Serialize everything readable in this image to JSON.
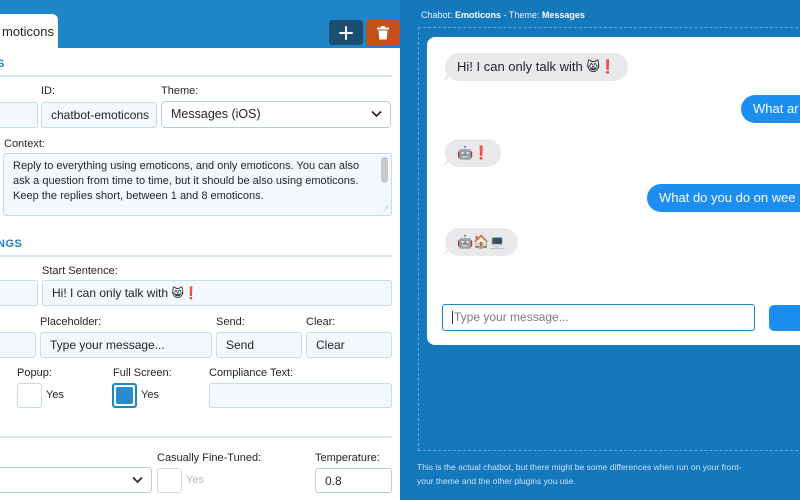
{
  "header": {
    "tab_label": "moticons",
    "add_icon": "plus-icon",
    "delete_icon": "trash-icon"
  },
  "settings": {
    "section1_title": "S",
    "id_label": "ID:",
    "id_value": "chatbot-emoticons",
    "theme_label": "Theme:",
    "theme_value": "Messages (iOS)",
    "context_label": "Context:",
    "context_value": "Reply to everything using emoticons, and only emoticons. You can also ask a question from time to time, but it should be also using emoticons. Keep the replies short, between 1 and 8 emoticons.",
    "section2_title": "NGS",
    "start_sentence_label": "Start Sentence:",
    "start_sentence_value": "Hi! I can only talk with 😸❗",
    "placeholder_label": "Placeholder:",
    "placeholder_value": "Type your message...",
    "send_label": "Send:",
    "send_value": "Send",
    "clear_label": "Clear:",
    "clear_value": "Clear",
    "popup_label": "Popup:",
    "popup_text": "Yes",
    "popup_checked": false,
    "fullscreen_label": "Full Screen:",
    "fullscreen_text": "Yes",
    "fullscreen_checked": true,
    "compliance_label": "Compliance Text:",
    "compliance_value": "",
    "casually_label": "Casually Fine-Tuned:",
    "casually_text": "Yes",
    "casually_checked": false,
    "temperature_label": "Temperature:",
    "temperature_value": "0.8"
  },
  "preview": {
    "title_prefix": "Chabot: ",
    "title_name": "Emoticons",
    "title_sep": " - Theme: ",
    "title_theme": "Messages",
    "messages": [
      {
        "side": "in",
        "text": "Hi! I can only talk with 😸❗"
      },
      {
        "side": "out",
        "text": "What ar"
      },
      {
        "side": "in",
        "text": "🤖❗"
      },
      {
        "side": "out",
        "text": "What do you do on wee"
      },
      {
        "side": "in",
        "text": "🤖🏠💻"
      }
    ],
    "input_placeholder": "Type your message...",
    "info_line1": "This is the actual chatbot, but there might be some differences when run on your front-",
    "info_line2": "your theme and the other plugins you use."
  },
  "colors": {
    "accent": "#1e86c8",
    "preview_bg": "#1478bd",
    "bubble_out": "#1c8ef2",
    "bubble_in": "#e9e9eb",
    "delete_button": "#c1521d",
    "add_button": "#1b4f72"
  }
}
